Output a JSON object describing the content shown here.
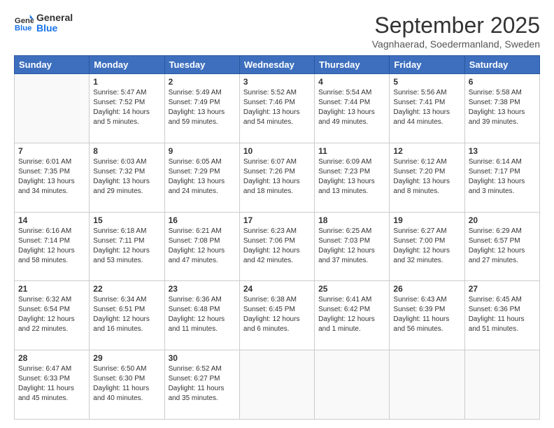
{
  "header": {
    "logo": {
      "line1": "General",
      "line2": "Blue"
    },
    "title": "September 2025",
    "location": "Vagnhaerad, Soedermanland, Sweden"
  },
  "weekdays": [
    "Sunday",
    "Monday",
    "Tuesday",
    "Wednesday",
    "Thursday",
    "Friday",
    "Saturday"
  ],
  "weeks": [
    [
      {
        "day": "",
        "info": ""
      },
      {
        "day": "1",
        "info": "Sunrise: 5:47 AM\nSunset: 7:52 PM\nDaylight: 14 hours\nand 5 minutes."
      },
      {
        "day": "2",
        "info": "Sunrise: 5:49 AM\nSunset: 7:49 PM\nDaylight: 13 hours\nand 59 minutes."
      },
      {
        "day": "3",
        "info": "Sunrise: 5:52 AM\nSunset: 7:46 PM\nDaylight: 13 hours\nand 54 minutes."
      },
      {
        "day": "4",
        "info": "Sunrise: 5:54 AM\nSunset: 7:44 PM\nDaylight: 13 hours\nand 49 minutes."
      },
      {
        "day": "5",
        "info": "Sunrise: 5:56 AM\nSunset: 7:41 PM\nDaylight: 13 hours\nand 44 minutes."
      },
      {
        "day": "6",
        "info": "Sunrise: 5:58 AM\nSunset: 7:38 PM\nDaylight: 13 hours\nand 39 minutes."
      }
    ],
    [
      {
        "day": "7",
        "info": "Sunrise: 6:01 AM\nSunset: 7:35 PM\nDaylight: 13 hours\nand 34 minutes."
      },
      {
        "day": "8",
        "info": "Sunrise: 6:03 AM\nSunset: 7:32 PM\nDaylight: 13 hours\nand 29 minutes."
      },
      {
        "day": "9",
        "info": "Sunrise: 6:05 AM\nSunset: 7:29 PM\nDaylight: 13 hours\nand 24 minutes."
      },
      {
        "day": "10",
        "info": "Sunrise: 6:07 AM\nSunset: 7:26 PM\nDaylight: 13 hours\nand 18 minutes."
      },
      {
        "day": "11",
        "info": "Sunrise: 6:09 AM\nSunset: 7:23 PM\nDaylight: 13 hours\nand 13 minutes."
      },
      {
        "day": "12",
        "info": "Sunrise: 6:12 AM\nSunset: 7:20 PM\nDaylight: 13 hours\nand 8 minutes."
      },
      {
        "day": "13",
        "info": "Sunrise: 6:14 AM\nSunset: 7:17 PM\nDaylight: 13 hours\nand 3 minutes."
      }
    ],
    [
      {
        "day": "14",
        "info": "Sunrise: 6:16 AM\nSunset: 7:14 PM\nDaylight: 12 hours\nand 58 minutes."
      },
      {
        "day": "15",
        "info": "Sunrise: 6:18 AM\nSunset: 7:11 PM\nDaylight: 12 hours\nand 53 minutes."
      },
      {
        "day": "16",
        "info": "Sunrise: 6:21 AM\nSunset: 7:08 PM\nDaylight: 12 hours\nand 47 minutes."
      },
      {
        "day": "17",
        "info": "Sunrise: 6:23 AM\nSunset: 7:06 PM\nDaylight: 12 hours\nand 42 minutes."
      },
      {
        "day": "18",
        "info": "Sunrise: 6:25 AM\nSunset: 7:03 PM\nDaylight: 12 hours\nand 37 minutes."
      },
      {
        "day": "19",
        "info": "Sunrise: 6:27 AM\nSunset: 7:00 PM\nDaylight: 12 hours\nand 32 minutes."
      },
      {
        "day": "20",
        "info": "Sunrise: 6:29 AM\nSunset: 6:57 PM\nDaylight: 12 hours\nand 27 minutes."
      }
    ],
    [
      {
        "day": "21",
        "info": "Sunrise: 6:32 AM\nSunset: 6:54 PM\nDaylight: 12 hours\nand 22 minutes."
      },
      {
        "day": "22",
        "info": "Sunrise: 6:34 AM\nSunset: 6:51 PM\nDaylight: 12 hours\nand 16 minutes."
      },
      {
        "day": "23",
        "info": "Sunrise: 6:36 AM\nSunset: 6:48 PM\nDaylight: 12 hours\nand 11 minutes."
      },
      {
        "day": "24",
        "info": "Sunrise: 6:38 AM\nSunset: 6:45 PM\nDaylight: 12 hours\nand 6 minutes."
      },
      {
        "day": "25",
        "info": "Sunrise: 6:41 AM\nSunset: 6:42 PM\nDaylight: 12 hours\nand 1 minute."
      },
      {
        "day": "26",
        "info": "Sunrise: 6:43 AM\nSunset: 6:39 PM\nDaylight: 11 hours\nand 56 minutes."
      },
      {
        "day": "27",
        "info": "Sunrise: 6:45 AM\nSunset: 6:36 PM\nDaylight: 11 hours\nand 51 minutes."
      }
    ],
    [
      {
        "day": "28",
        "info": "Sunrise: 6:47 AM\nSunset: 6:33 PM\nDaylight: 11 hours\nand 45 minutes."
      },
      {
        "day": "29",
        "info": "Sunrise: 6:50 AM\nSunset: 6:30 PM\nDaylight: 11 hours\nand 40 minutes."
      },
      {
        "day": "30",
        "info": "Sunrise: 6:52 AM\nSunset: 6:27 PM\nDaylight: 11 hours\nand 35 minutes."
      },
      {
        "day": "",
        "info": ""
      },
      {
        "day": "",
        "info": ""
      },
      {
        "day": "",
        "info": ""
      },
      {
        "day": "",
        "info": ""
      }
    ]
  ]
}
